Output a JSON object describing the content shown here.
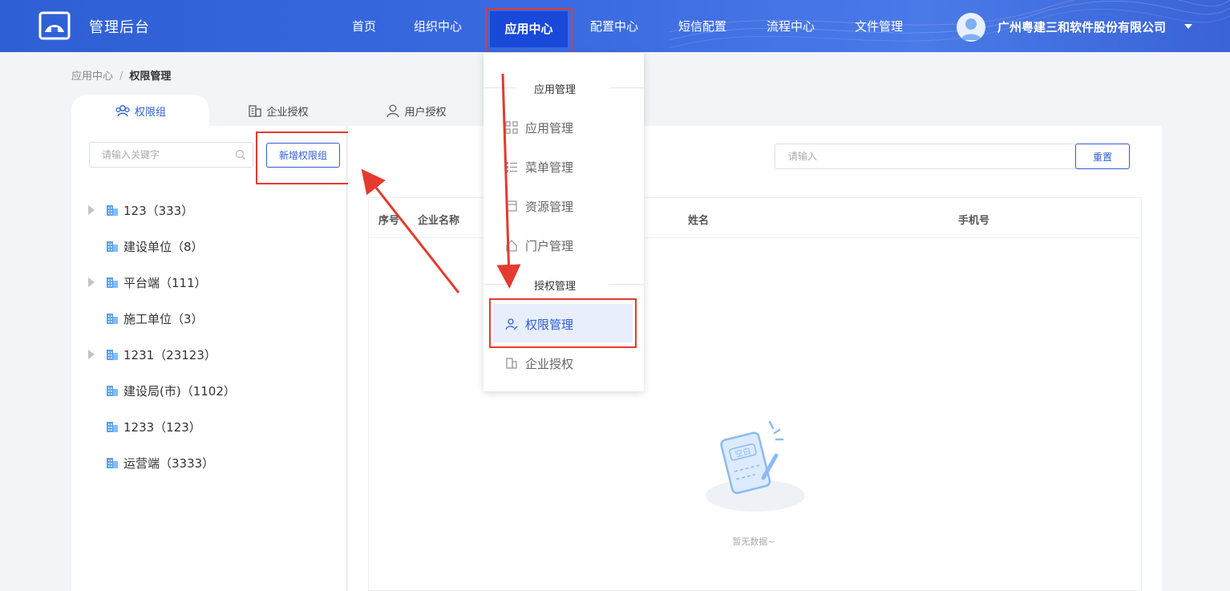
{
  "header": {
    "app_title": "管理后台",
    "nav": [
      {
        "label": "首页"
      },
      {
        "label": "组织中心"
      },
      {
        "label": "应用中心"
      },
      {
        "label": "配置中心"
      },
      {
        "label": "短信配置"
      },
      {
        "label": "流程中心"
      },
      {
        "label": "文件管理"
      }
    ],
    "active_nav": "应用中心",
    "company": "广州粤建三和软件股份有限公司",
    "icons": [
      "logo-icon",
      "avatar-icon",
      "caret-down-icon"
    ]
  },
  "breadcrumb": {
    "parent": "应用中心",
    "separator": "/",
    "current": "权限管理"
  },
  "tabs": [
    {
      "label": "权限组",
      "icon": "group-icon",
      "active": true
    },
    {
      "label": "企业授权",
      "icon": "building-icon",
      "active": false
    },
    {
      "label": "用户授权",
      "icon": "user-icon",
      "active": false
    }
  ],
  "left": {
    "search_placeholder": "请输入关键字",
    "add_button": "新增权限组",
    "tree": [
      {
        "label": "123（333）",
        "expandable": true
      },
      {
        "label": "建设单位（8）",
        "expandable": false
      },
      {
        "label": "平台端（111）",
        "expandable": true
      },
      {
        "label": "施工单位（3）",
        "expandable": false
      },
      {
        "label": "1231（23123）",
        "expandable": true
      },
      {
        "label": "建设局(市)（1102）",
        "expandable": false
      },
      {
        "label": "1233（123）",
        "expandable": false
      },
      {
        "label": "运营端（3333）",
        "expandable": false
      }
    ]
  },
  "right": {
    "search_placeholder": "请输入",
    "reset_button": "重置",
    "columns": [
      "序号",
      "企业名称",
      "姓名",
      "手机号"
    ],
    "empty_badge": "空白",
    "empty_text": "暂无数据~"
  },
  "dropdown": {
    "groups": [
      {
        "title": "应用管理",
        "items": [
          {
            "label": "应用管理",
            "icon": "grid-icon"
          },
          {
            "label": "菜单管理",
            "icon": "list-icon"
          },
          {
            "label": "资源管理",
            "icon": "box-icon"
          },
          {
            "label": "门户管理",
            "icon": "home-icon"
          }
        ]
      },
      {
        "title": "授权管理",
        "items": [
          {
            "label": "权限管理",
            "icon": "user-edit-icon",
            "active": true
          },
          {
            "label": "企业授权",
            "icon": "building-icon"
          }
        ]
      }
    ]
  },
  "colors": {
    "primary": "#2f5fd4",
    "header_bg": "#3a6ae0",
    "highlight_red": "#e53a2f",
    "active_nav_bg": "#1849d9"
  }
}
